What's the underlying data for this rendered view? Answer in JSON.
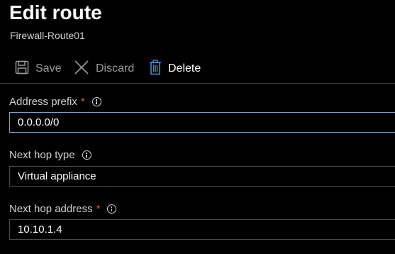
{
  "header": {
    "title": "Edit route",
    "subtitle": "Firewall-Route01"
  },
  "toolbar": {
    "save_label": "Save",
    "discard_label": "Discard",
    "delete_label": "Delete"
  },
  "form": {
    "address_prefix": {
      "label": "Address prefix",
      "required_mark": "*",
      "value": "0.0.0.0/0"
    },
    "next_hop_type": {
      "label": "Next hop type",
      "value": "Virtual appliance"
    },
    "next_hop_address": {
      "label": "Next hop address",
      "required_mark": "*",
      "value": "10.10.1.4"
    }
  },
  "colors": {
    "background": "#000000",
    "focus_border": "#6fa3d8",
    "required": "#e0544e",
    "delete_icon": "#3b8ede"
  },
  "icons": {
    "save": "save-icon",
    "discard": "close-icon",
    "delete": "trash-icon",
    "info": "info-icon"
  }
}
